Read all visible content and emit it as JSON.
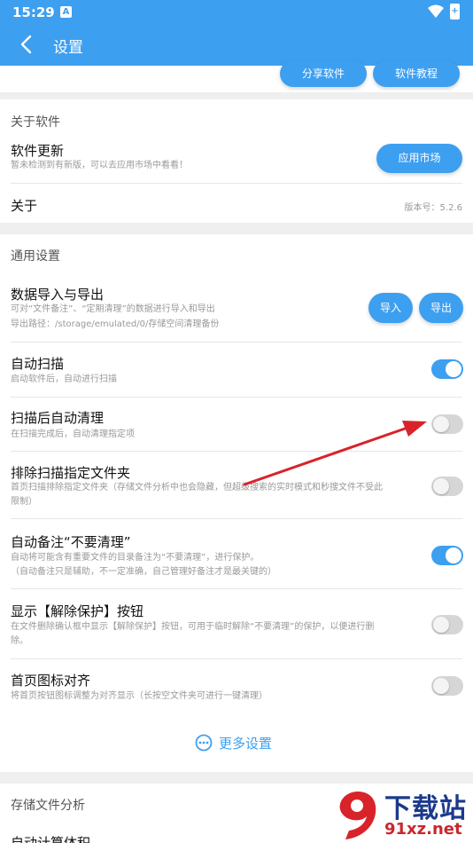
{
  "status": {
    "time": "15:29",
    "notify_badge": "A",
    "battery_badge": "+"
  },
  "header": {
    "title": "设置"
  },
  "share": {
    "share_label": "分享软件",
    "tutorial_label": "软件教程"
  },
  "about_section": {
    "title": "关于软件",
    "update": {
      "title": "软件更新",
      "desc": "暂未检测到有新版，可以去应用市场中看看！",
      "button": "应用市场"
    },
    "about": {
      "title": "关于",
      "version": "版本号：5.2.6"
    }
  },
  "general": {
    "title": "通用设置",
    "data_io": {
      "title": "数据导入与导出",
      "desc1": "可对“文件备注”、“定期清理”的数据进行导入和导出",
      "desc2": "导出路径：/storage/emulated/0/存储空间清理备份",
      "import": "导入",
      "export": "导出"
    },
    "items": [
      {
        "title": "自动扫描",
        "desc": "启动软件后，自动进行扫描",
        "on": true
      },
      {
        "title": "扫描后自动清理",
        "desc": "在扫描完成后，自动清理指定项",
        "on": false
      },
      {
        "title": "排除扫描指定文件夹",
        "desc": "首页扫描排除指定文件夹（存储文件分析中也会隐藏，但超级搜索的实时模式和秒搜文件不受此",
        "desc2": "限制）",
        "on": false
      },
      {
        "title": "自动备注“不要清理”",
        "desc": "自动将可能含有重要文件的目录备注为“不要清理”，进行保护。",
        "desc2": "（自动备注只是辅助，不一定准确，自己管理好备注才是最关键的）",
        "on": true
      },
      {
        "title": "显示【解除保护】按钮",
        "desc": "在文件删除确认框中显示【解除保护】按钮，可用于临时解除“不要清理”的保护，以便进行删",
        "desc2": "除。",
        "on": false
      },
      {
        "title": "首页图标对齐",
        "desc": "将首页按钮图标调整为对齐显示（长按空文件夹可进行一键清理）",
        "on": false
      }
    ],
    "more": "更多设置"
  },
  "storage": {
    "title": "存储文件分析",
    "partial_row": "自动计算体积"
  },
  "watermark": {
    "brand": "下载站",
    "url": "91xz.net",
    "logo_text": "9"
  },
  "colors": {
    "accent": "#3d9ff0",
    "arrow": "#d8232a",
    "toggle_off": "#d6d6d6"
  }
}
